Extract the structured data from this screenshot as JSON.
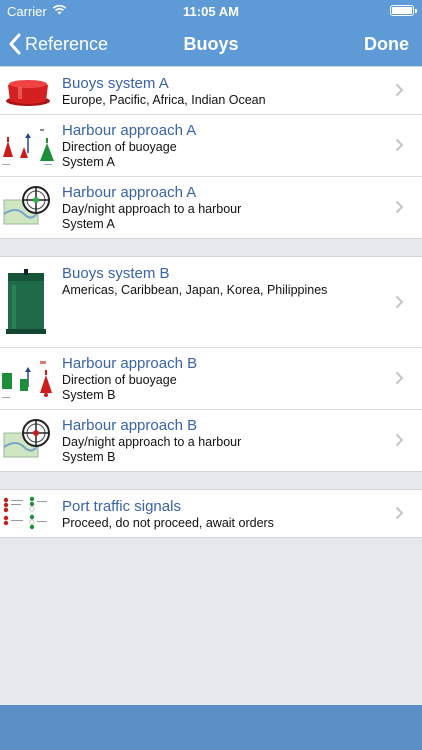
{
  "status": {
    "carrier": "Carrier",
    "time": "11:05 AM"
  },
  "nav": {
    "back_label": "Reference",
    "title": "Buoys",
    "done_label": "Done"
  },
  "sections": [
    {
      "rows": [
        {
          "title": "Buoys system A",
          "lines": [
            "Europe, Pacific, Africa, Indian Ocean"
          ],
          "thumb": "red-buoy"
        },
        {
          "title": "Harbour approach A",
          "lines": [
            "Direction of buoyage",
            "System A"
          ],
          "thumb": "buoyage-direction-a"
        },
        {
          "title": "Harbour approach A",
          "lines": [
            "Day/night approach to a harbour",
            "System A"
          ],
          "thumb": "harbour-chart-compass"
        }
      ]
    },
    {
      "rows": [
        {
          "title": "Buoys system B",
          "lines": [
            "Americas, Caribbean, Japan, Korea, Philippines"
          ],
          "thumb": "green-buoy"
        },
        {
          "title": "Harbour approach B",
          "lines": [
            "Direction of buoyage",
            "System B"
          ],
          "thumb": "buoyage-direction-b"
        },
        {
          "title": "Harbour approach B",
          "lines": [
            "Day/night approach to a harbour",
            "System B"
          ],
          "thumb": "harbour-chart-compass"
        }
      ]
    },
    {
      "rows": [
        {
          "title": "Port traffic signals",
          "lines": [
            "Proceed, do not proceed, await orders"
          ],
          "thumb": "traffic-signals"
        }
      ]
    }
  ],
  "colors": {
    "navbar": "#5d9ad6",
    "bottombar": "#5b8fc6",
    "link": "#3a63a6",
    "background": "#e8e9ee"
  }
}
